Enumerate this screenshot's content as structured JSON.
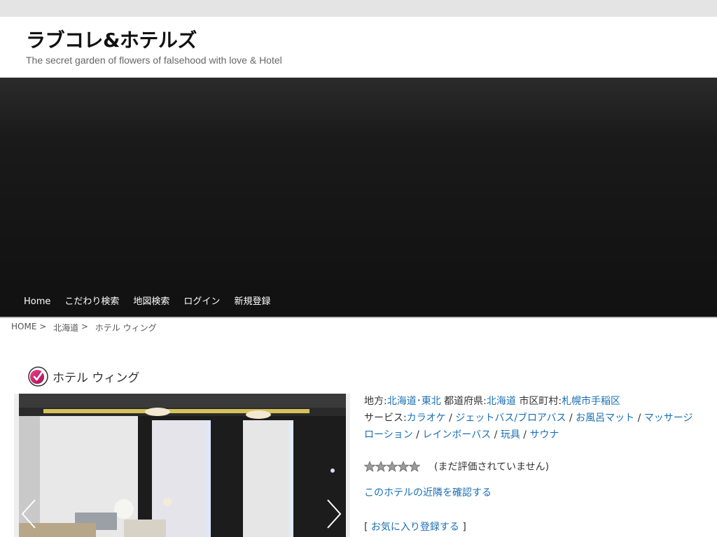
{
  "site": {
    "title": "ラブコレ&ホテルズ",
    "description": "The secret garden of flowers of falsehood with love & Hotel"
  },
  "nav": {
    "items": [
      {
        "label": "Home"
      },
      {
        "label": "こだわり検索"
      },
      {
        "label": "地図検索"
      },
      {
        "label": "ログイン"
      },
      {
        "label": "新規登録"
      }
    ]
  },
  "breadcrumb": {
    "home": "HOME",
    "sep": " > ",
    "region": "北海道",
    "current": "ホテル ウィング"
  },
  "hotel": {
    "name": "ホテル ウィング",
    "area_label": "地方:",
    "area": "北海道･東北",
    "pref_label": "都道府県:",
    "pref": "北海道",
    "city_label": "市区町村:",
    "city": "札幌市手稲区",
    "service_label": "サービス:",
    "services": [
      "カラオケ",
      "ジェットバス/ブロアバス",
      "お風呂マット",
      "マッサージローション",
      "レインボーバス",
      "玩具",
      "サウナ"
    ],
    "service_sep": " / ",
    "rating_text": "(まだ評価されていません)",
    "rating_stars": 0,
    "nearby_link": "このホテルの近隣を確認する",
    "fav_open": "[ ",
    "fav_link": "お気に入り登録する",
    "fav_close": " ]"
  },
  "colors": {
    "link": "#1a6fb5",
    "header_bg": "#ffffff",
    "hero_bg": "#151515"
  }
}
